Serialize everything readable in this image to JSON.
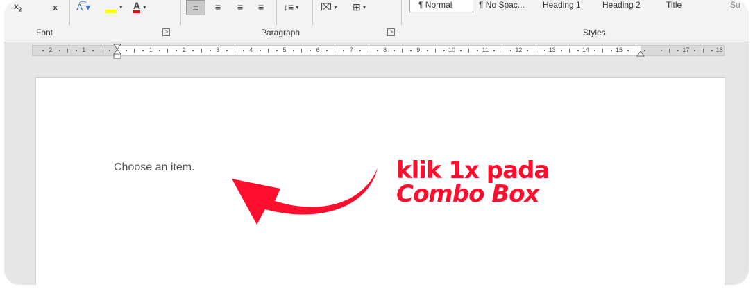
{
  "ribbon": {
    "groups": {
      "font": "Font",
      "paragraph": "Paragraph",
      "styles": "Styles"
    },
    "styles_gallery": [
      "¶ Normal",
      "¶ No Spac...",
      "Heading 1",
      "Heading 2",
      "Title",
      "Su"
    ],
    "colors": {
      "highlight": "#ffff00",
      "font_color": "#ff0000"
    }
  },
  "ruler": {
    "labels": [
      "2",
      "1",
      "1",
      "2",
      "3",
      "4",
      "5",
      "6",
      "7",
      "8",
      "9",
      "10",
      "11",
      "12",
      "13",
      "14",
      "15",
      "17",
      "18"
    ]
  },
  "document": {
    "content_control_placeholder": "Choose an item."
  },
  "annotation": {
    "line1": "klik 1x pada",
    "line2": "Combo Box",
    "color": "#ff0d2d"
  }
}
